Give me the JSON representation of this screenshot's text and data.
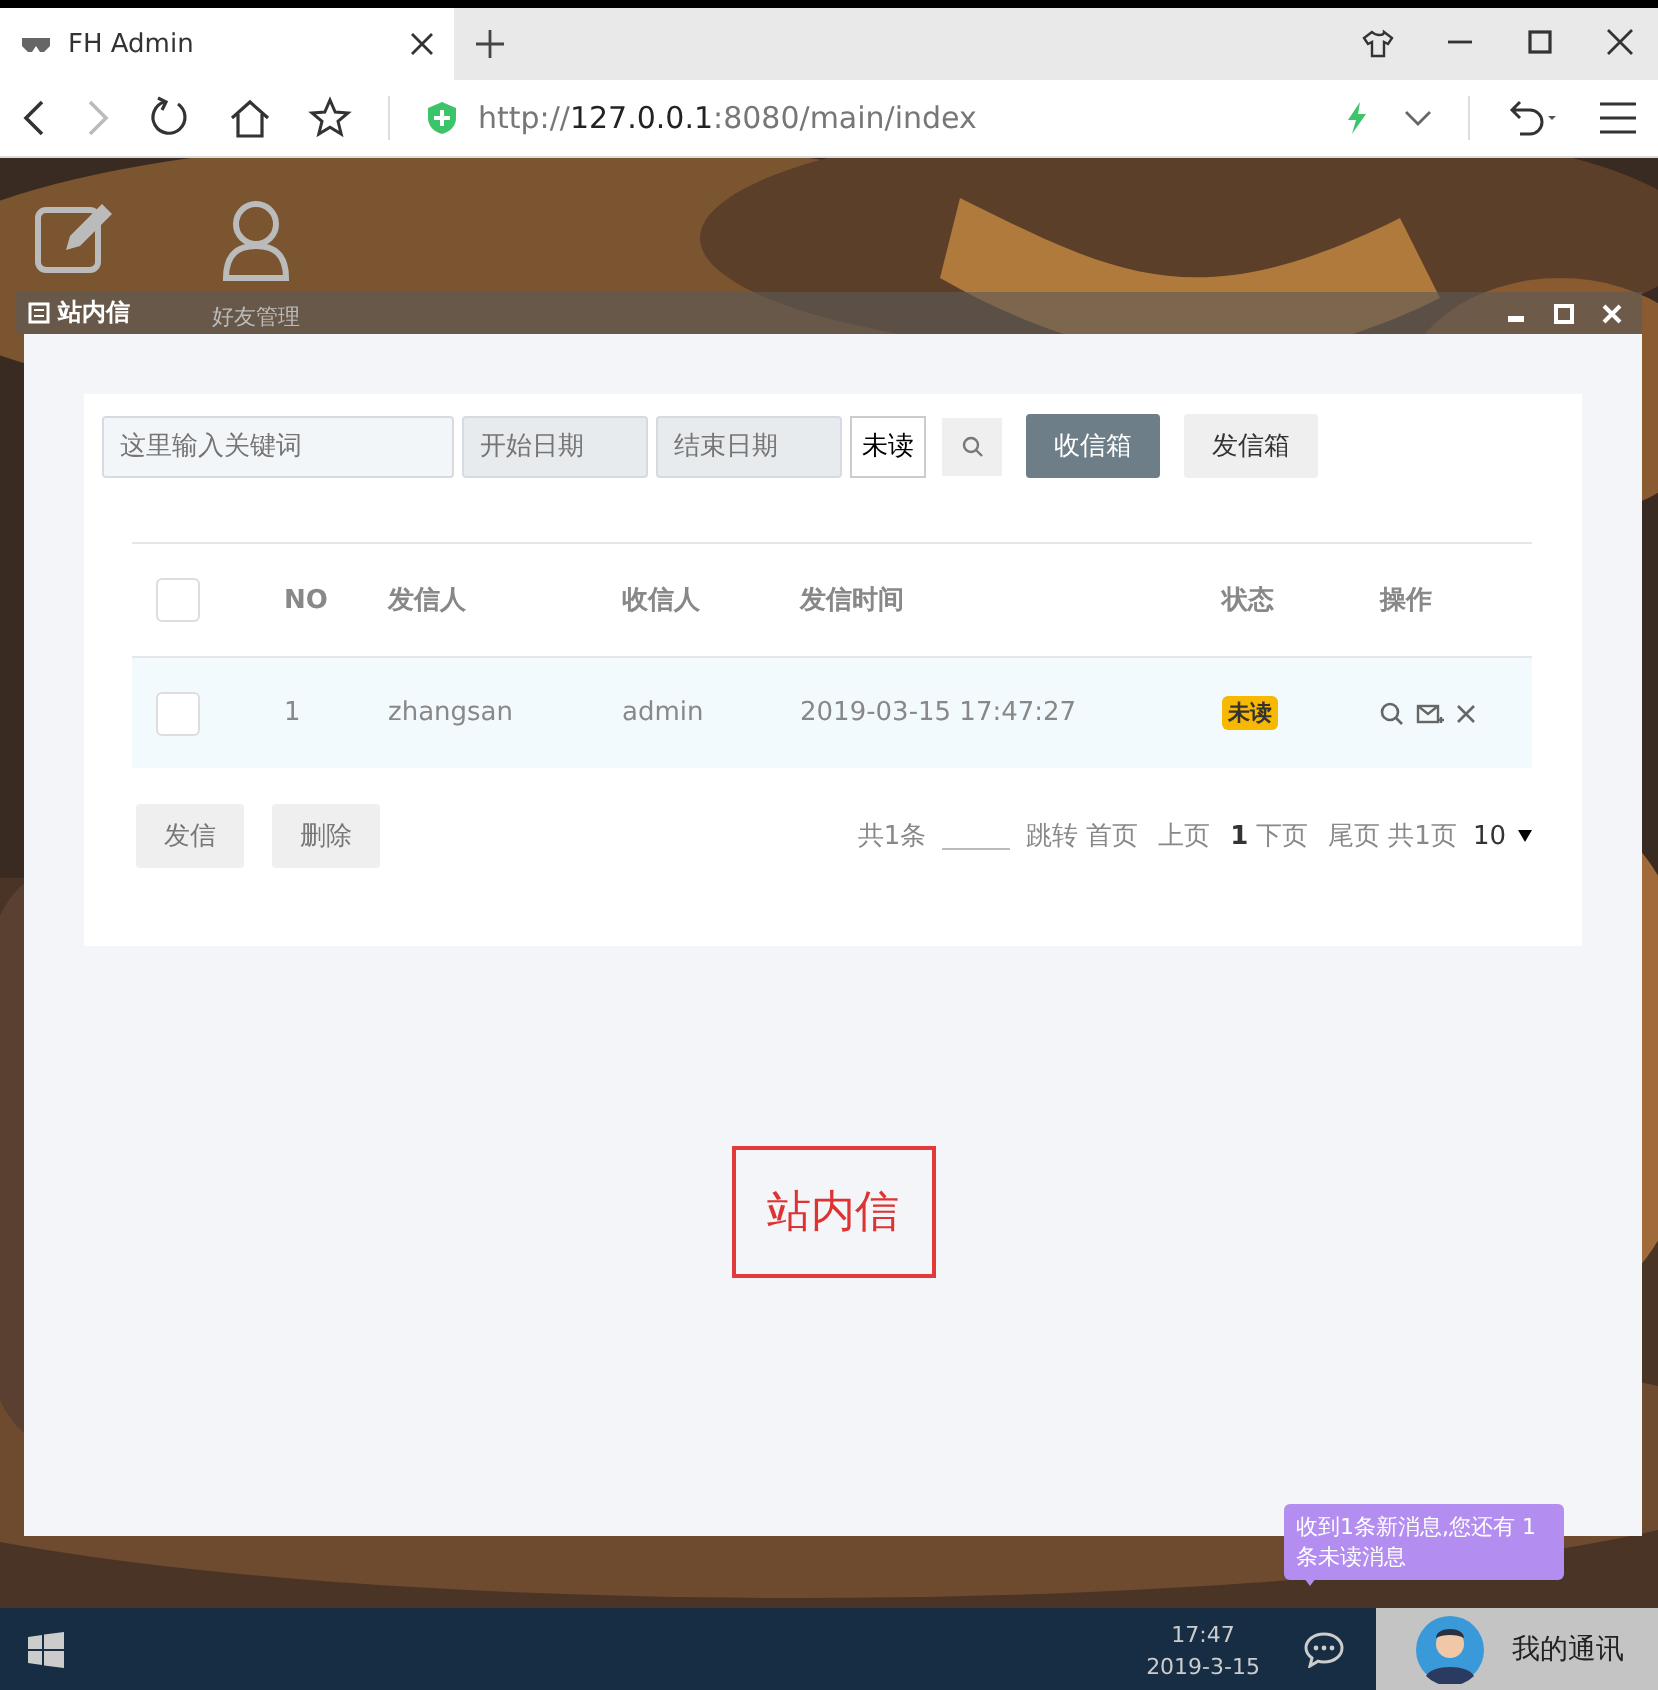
{
  "browser": {
    "tab_title": "FH Admin",
    "url_host": "127.0.0.1",
    "url_scheme": "http://",
    "url_rest": ":8080/main/index"
  },
  "desktop": {
    "icons": [
      {
        "kind": "edit"
      },
      {
        "kind": "user",
        "label": "好友管理"
      }
    ]
  },
  "window": {
    "title": "站内信",
    "filters": {
      "keyword_placeholder": "这里输入关键词",
      "start_placeholder": "开始日期",
      "end_placeholder": "结束日期",
      "status": "未读"
    },
    "boxes": [
      {
        "label": "收信箱",
        "selected": true
      },
      {
        "label": "发信箱",
        "selected": false
      }
    ],
    "table": {
      "select_all": false,
      "columns": [
        "NO",
        "发信人",
        "收信人",
        "发信时间",
        "状态",
        "操作"
      ],
      "rows": [
        {
          "checked": false,
          "no": "1",
          "sender": "zhangsan",
          "receiver": "admin",
          "time": "2019-03-15 17:47:27",
          "status": "未读"
        }
      ]
    },
    "actions": [
      "发信",
      "删除"
    ],
    "pager": {
      "total": "共1条",
      "jump": "跳转",
      "first": "首页",
      "prev": "上页",
      "current": "1",
      "next": "下页",
      "last": "尾页",
      "pages": "共1页",
      "size": "10"
    },
    "annotation": "站内信"
  },
  "taskbar": {
    "time": "17:47",
    "date": "2019-3-15",
    "notification": "收到1条新消息,您还有 1 条未读消息",
    "contact": "我的通讯"
  }
}
